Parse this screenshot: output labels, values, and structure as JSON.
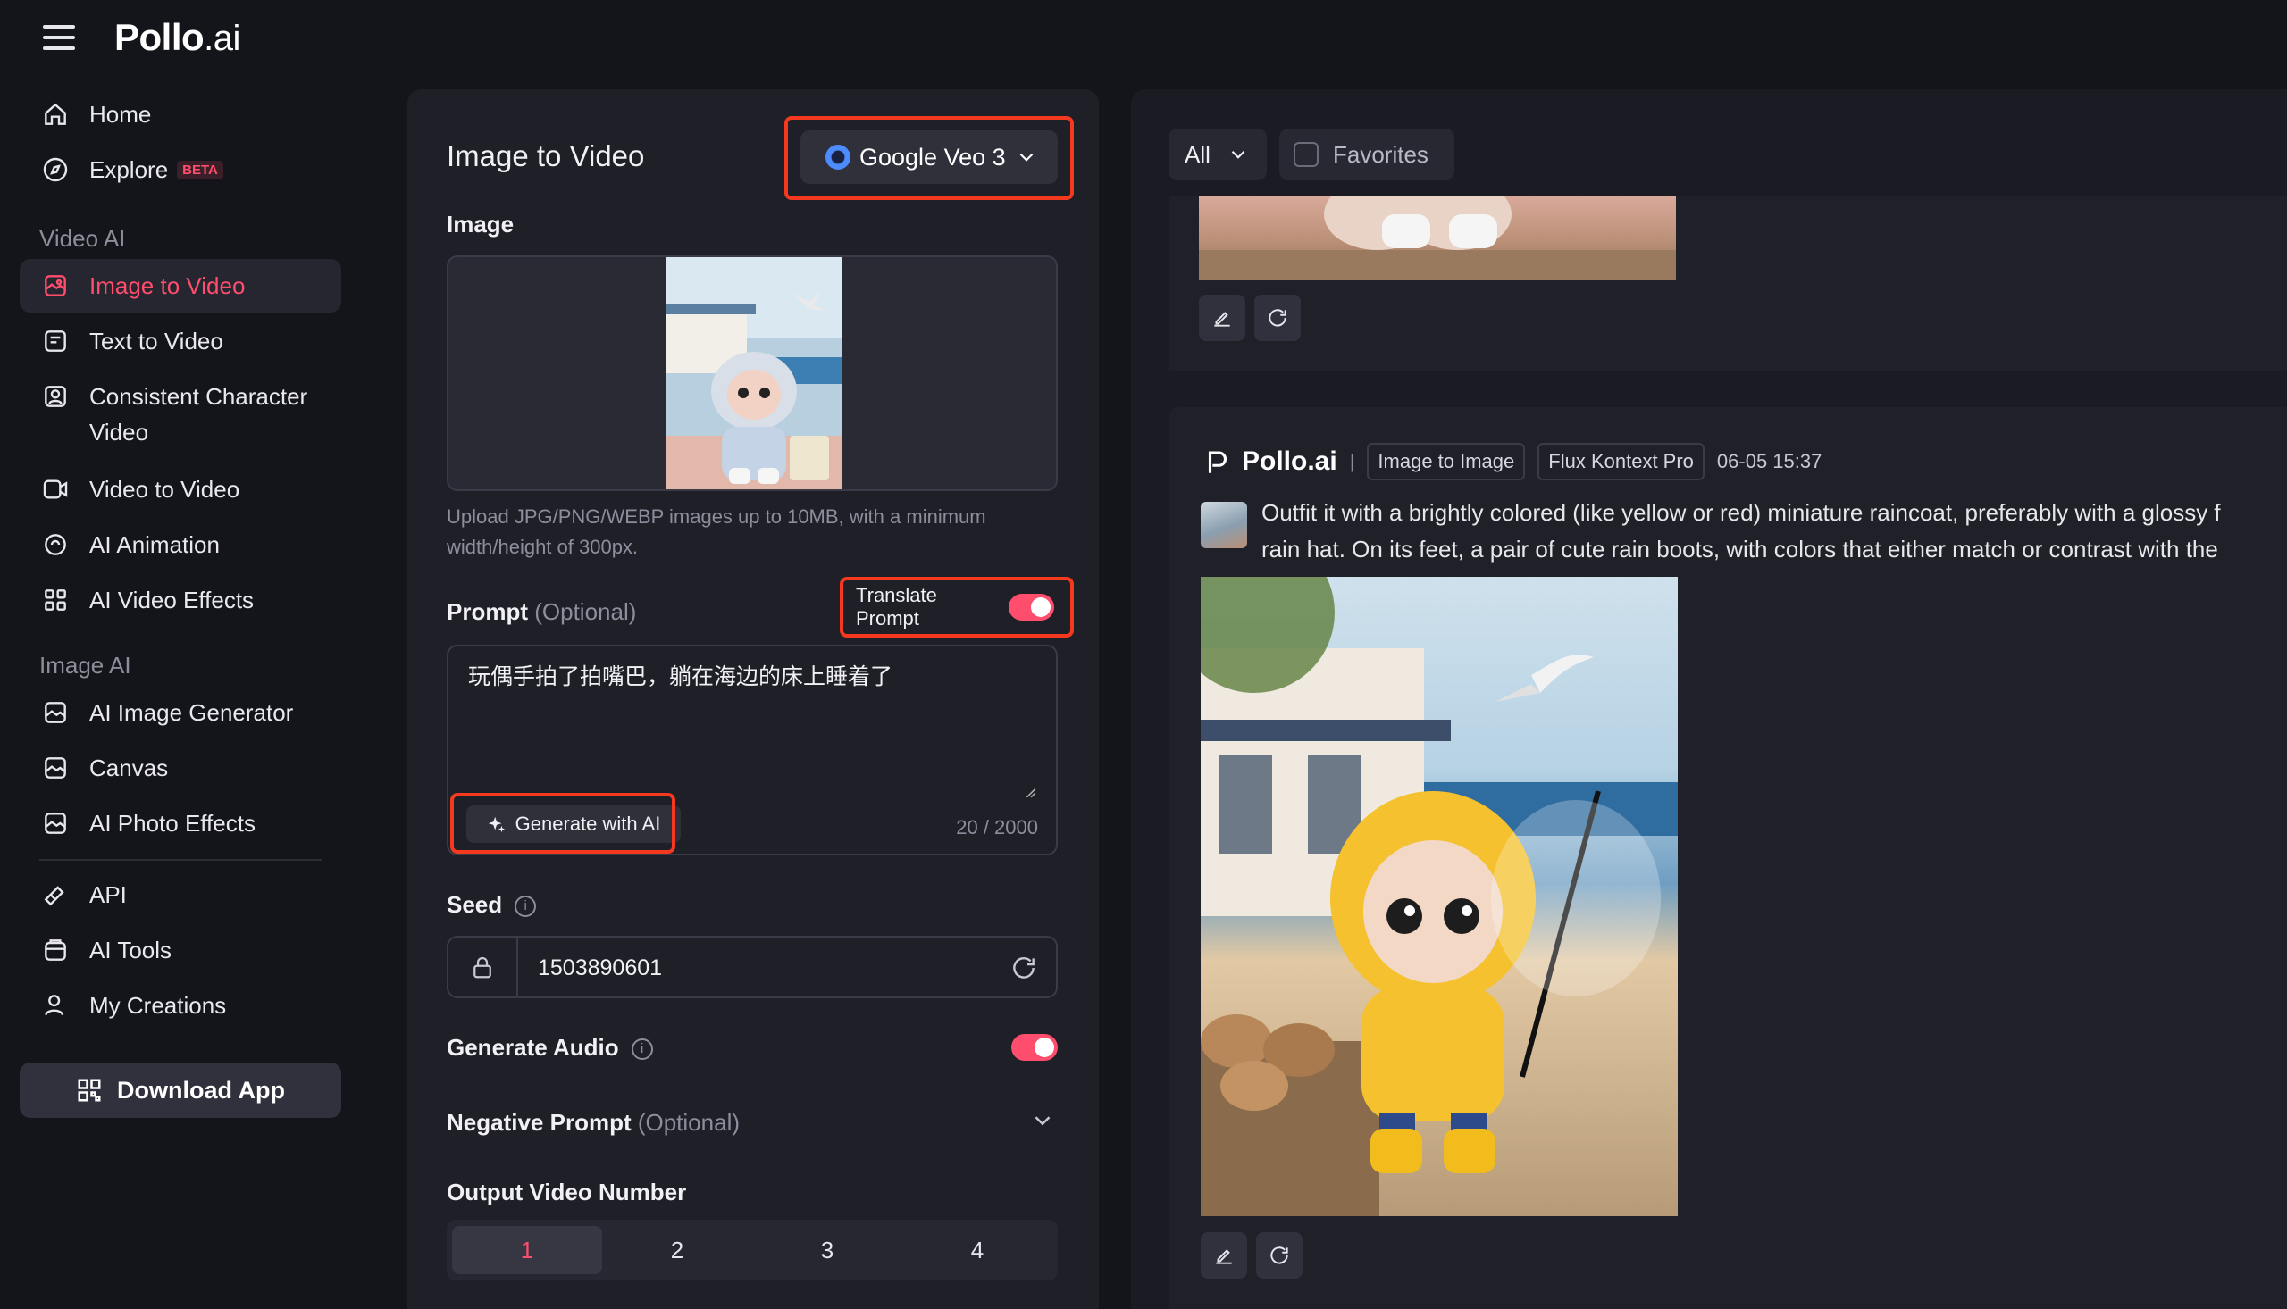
{
  "app": {
    "logo_bold": "Pollo",
    "logo_suffix": ".ai"
  },
  "sidebar": {
    "home": "Home",
    "explore": "Explore",
    "explore_badge": "BETA",
    "video_section": "Video AI",
    "image_to_video": "Image to Video",
    "text_to_video": "Text to Video",
    "consistent_1": "Consistent Character",
    "consistent_2": "Video",
    "video_to_video": "Video to Video",
    "ai_animation": "AI Animation",
    "ai_video_effects": "AI Video Effects",
    "image_section": "Image AI",
    "ai_image_generator": "AI Image Generator",
    "canvas": "Canvas",
    "ai_photo_effects": "AI Photo Effects",
    "api": "API",
    "ai_tools": "AI Tools",
    "my_creations": "My Creations",
    "download_app": "Download App"
  },
  "panel": {
    "title": "Image to Video",
    "model": "Google Veo 3",
    "image_label": "Image",
    "upload_hint": "Upload JPG/PNG/WEBP images up to 10MB, with a minimum width/height of 300px.",
    "prompt_label": "Prompt",
    "optional": "(Optional)",
    "translate_prompt": "Translate Prompt",
    "translate_on": true,
    "prompt_text": "玩偶手拍了拍嘴巴，躺在海边的床上睡着了",
    "generate_with_ai": "Generate with AI",
    "char_count": "20 / 2000",
    "seed_label": "Seed",
    "seed_value": "1503890601",
    "generate_audio": "Generate Audio",
    "audio_on": true,
    "negative_prompt": "Negative Prompt",
    "output_label": "Output Video Number",
    "output_options": [
      "1",
      "2",
      "3",
      "4"
    ],
    "output_selected": "1"
  },
  "history": {
    "filter_all": "All",
    "favorites": "Favorites",
    "entry": {
      "brand": "Pollo.ai",
      "separator": "|",
      "tag_mode": "Image to Image",
      "tag_model": "Flux Kontext Pro",
      "time": "06-05 15:37",
      "desc_line1": "Outfit it with a brightly colored (like yellow or red) miniature raincoat, preferably with a glossy f",
      "desc_line2": "rain hat. On its feet, a pair of cute rain boots, with colors that either match or contrast with the"
    }
  },
  "colors": {
    "accent": "#ff4d6d",
    "highlight": "#f4391e",
    "bg": "#14151b",
    "panel": "#1e1f27"
  }
}
